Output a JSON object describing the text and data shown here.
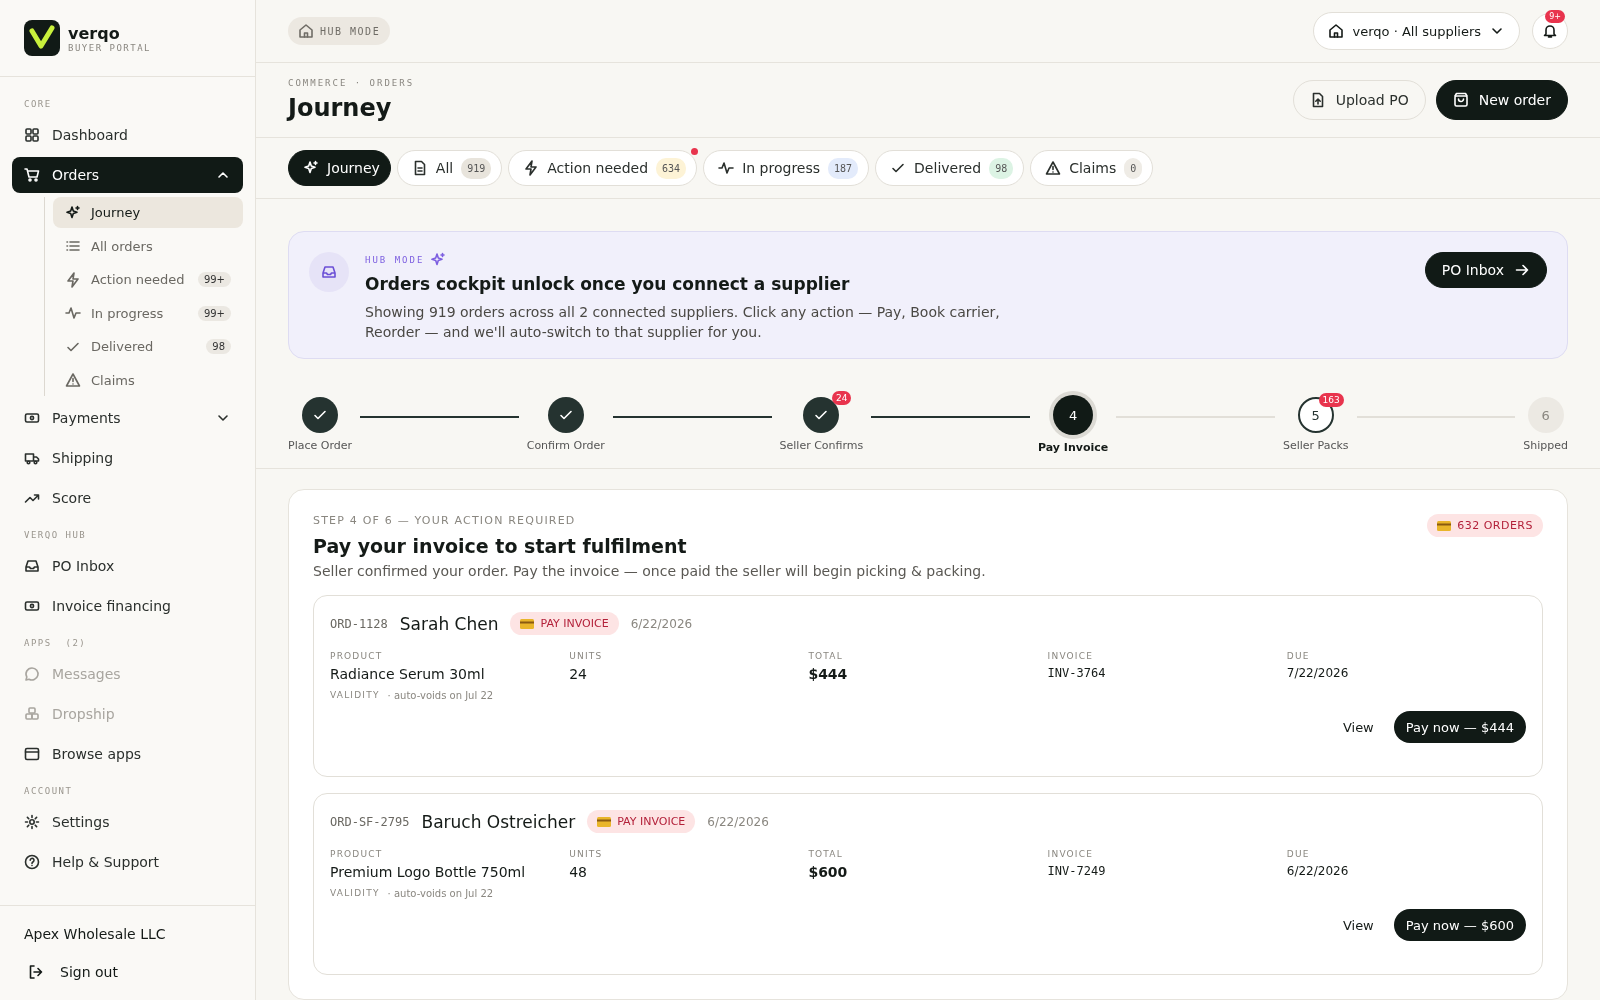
{
  "brand": {
    "name": "verqo",
    "subtitle": "BUYER PORTAL"
  },
  "sidebar": {
    "sections": [
      {
        "title": "CORE",
        "items": [
          {
            "label": "Dashboard",
            "selected": false
          },
          {
            "label": "Orders",
            "selected": true,
            "expanded": true,
            "children": [
              {
                "label": "Journey",
                "selected": true
              },
              {
                "label": "All orders",
                "selected": false
              },
              {
                "label": "Action needed",
                "selected": false,
                "count": "99+"
              },
              {
                "label": "In progress",
                "selected": false,
                "count": "99+"
              },
              {
                "label": "Delivered",
                "selected": false,
                "count": "98"
              },
              {
                "label": "Claims",
                "selected": false
              }
            ]
          },
          {
            "label": "Payments",
            "selected": false,
            "expanded": false
          },
          {
            "label": "Shipping",
            "selected": false
          },
          {
            "label": "Score",
            "selected": false
          }
        ]
      },
      {
        "title": "VERQO HUB",
        "items": [
          {
            "label": "PO Inbox",
            "selected": false
          },
          {
            "label": "Invoice financing",
            "selected": false
          }
        ]
      },
      {
        "title": "APPS  (2)",
        "items": [
          {
            "label": "Messages",
            "selected": false,
            "disabled": true
          },
          {
            "label": "Dropship",
            "selected": false,
            "disabled": true
          },
          {
            "label": "Browse apps",
            "selected": false
          }
        ]
      },
      {
        "title": "ACCOUNT",
        "items": [
          {
            "label": "Settings",
            "selected": false
          },
          {
            "label": "Help & Support",
            "selected": false
          }
        ]
      }
    ],
    "account": "Apex Wholesale LLC",
    "sign_out": "Sign out"
  },
  "topbar": {
    "mode": "HUB MODE",
    "supplier": "verqo · All suppliers",
    "notifications": "9+"
  },
  "header": {
    "breadcrumb": "COMMERCE · ORDERS",
    "title": "Journey",
    "actions": [
      {
        "label": "Upload PO",
        "kind": "secondary"
      },
      {
        "label": "New order",
        "kind": "primary"
      }
    ]
  },
  "tabs": [
    {
      "label": "Journey",
      "selected": true
    },
    {
      "label": "All",
      "selected": false,
      "count": "919",
      "color": "#e8e4dc"
    },
    {
      "label": "Action needed",
      "selected": false,
      "count": "634",
      "color": "#fdf3d6",
      "alert": true
    },
    {
      "label": "In progress",
      "selected": false,
      "count": "187",
      "color": "#e3ebfb"
    },
    {
      "label": "Delivered",
      "selected": false,
      "count": "98",
      "color": "#dcf3e4"
    },
    {
      "label": "Claims",
      "selected": false,
      "count": "0",
      "color": "#efece6"
    }
  ],
  "banner": {
    "eyebrow": "HUB MODE",
    "title": "Orders cockpit unlock once you connect a supplier",
    "text": "Showing 919 orders across all 2 connected suppliers. Click any action — Pay, Book carrier, Reorder — and we'll auto-switch to that supplier for you.",
    "button": "PO Inbox"
  },
  "steps": [
    {
      "label": "Place Order",
      "kind": "done"
    },
    {
      "label": "Confirm Order",
      "kind": "done"
    },
    {
      "label": "Seller Confirms",
      "kind": "done",
      "count": "24"
    },
    {
      "label": "Pay Invoice",
      "number": "4",
      "kind": "current"
    },
    {
      "label": "Seller Packs",
      "number": "5",
      "kind": "pending",
      "count": "163"
    },
    {
      "label": "Shipped",
      "number": "6",
      "kind": "future"
    }
  ],
  "panel": {
    "eyebrow": "STEP 4 OF 6 — YOUR ACTION REQUIRED",
    "title": "Pay your invoice to start fulfilment",
    "text": "Seller confirmed your order. Pay the invoice — once paid the seller will begin picking & packing.",
    "badge": "632 ORDERS",
    "orders": [
      {
        "id": "ORD-1128",
        "customer": "Sarah Chen",
        "status": "PAY INVOICE",
        "date": "6/22/2026",
        "fields": [
          {
            "label": "PRODUCT",
            "value": "Radiance Serum 30ml",
            "kind": "text"
          },
          {
            "label": "UNITS",
            "value": "24",
            "kind": "text"
          },
          {
            "label": "TOTAL",
            "value": "$444",
            "kind": "money"
          },
          {
            "label": "INVOICE",
            "value": "INV-3764",
            "kind": "code"
          },
          {
            "label": "DUE",
            "value": "7/22/2026",
            "kind": "date"
          }
        ],
        "validity_label": "VALIDITY",
        "validity": "· auto-voids on Jul 22",
        "view": "View",
        "pay": "Pay now — $444"
      },
      {
        "id": "ORD-SF-2795",
        "customer": "Baruch Ostreicher",
        "status": "PAY INVOICE",
        "date": "6/22/2026",
        "fields": [
          {
            "label": "PRODUCT",
            "value": "Premium Logo Bottle 750ml",
            "kind": "text"
          },
          {
            "label": "UNITS",
            "value": "48",
            "kind": "text"
          },
          {
            "label": "TOTAL",
            "value": "$600",
            "kind": "money"
          },
          {
            "label": "INVOICE",
            "value": "INV-7249",
            "kind": "code"
          },
          {
            "label": "DUE",
            "value": "6/22/2026",
            "kind": "date"
          }
        ],
        "validity_label": "VALIDITY",
        "validity": "· auto-voids on Jul 22",
        "view": "View",
        "pay": "Pay now — $600"
      }
    ]
  }
}
